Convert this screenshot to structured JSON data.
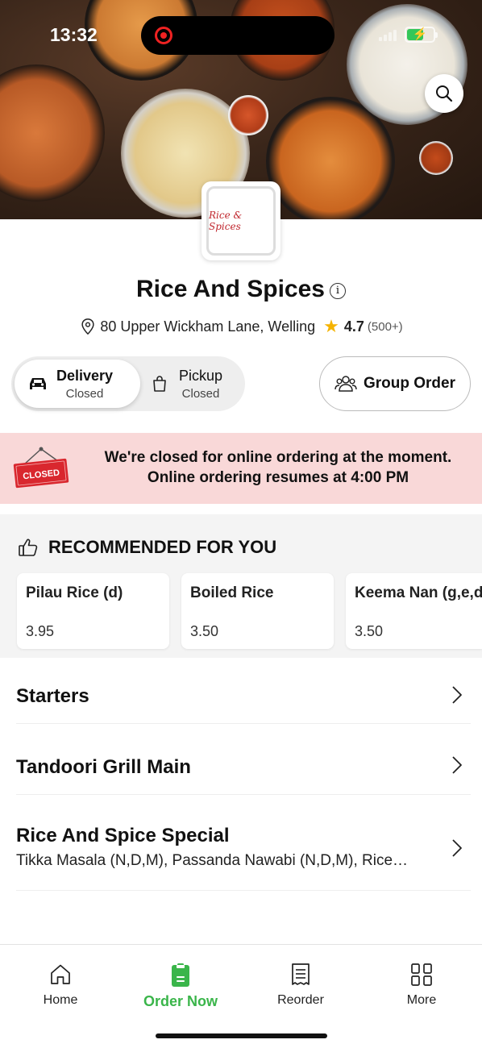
{
  "status_bar": {
    "time": "13:32"
  },
  "restaurant": {
    "name": "Rice And Spices",
    "logo_text": "Rice & Spices",
    "address": "80 Upper Wickham Lane, Welling",
    "rating": "4.7",
    "rating_count": "(500+)"
  },
  "modes": {
    "delivery": {
      "label": "Delivery",
      "status": "Closed"
    },
    "pickup": {
      "label": "Pickup",
      "status": "Closed"
    },
    "group_order_label": "Group Order"
  },
  "closed_banner": {
    "sign_text": "CLOSED",
    "line1": "We're closed for online ordering at the moment.",
    "line2": "Online ordering resumes at 4:00 PM"
  },
  "recommended": {
    "title": "RECOMMENDED FOR YOU",
    "items": [
      {
        "name": "Pilau Rice (d)",
        "price": "3.95"
      },
      {
        "name": "Boiled Rice",
        "price": "3.50"
      },
      {
        "name": "Keema Nan (g,e,d",
        "price": "3.50"
      }
    ]
  },
  "categories": [
    {
      "name": "Starters",
      "description": ""
    },
    {
      "name": "Tandoori Grill Main",
      "description": ""
    },
    {
      "name": "Rice And Spice Special",
      "description": "Tikka Masala (N,D,M), Passanda Nawabi (N,D,M), Rice…"
    }
  ],
  "bottom_nav": {
    "home": "Home",
    "order_now": "Order Now",
    "reorder": "Reorder",
    "more": "More"
  },
  "colors": {
    "accent_green": "#3ab54a",
    "closed_banner_bg": "#f9d8d8",
    "closed_sign_red": "#d9272e",
    "star": "#f5b301"
  }
}
